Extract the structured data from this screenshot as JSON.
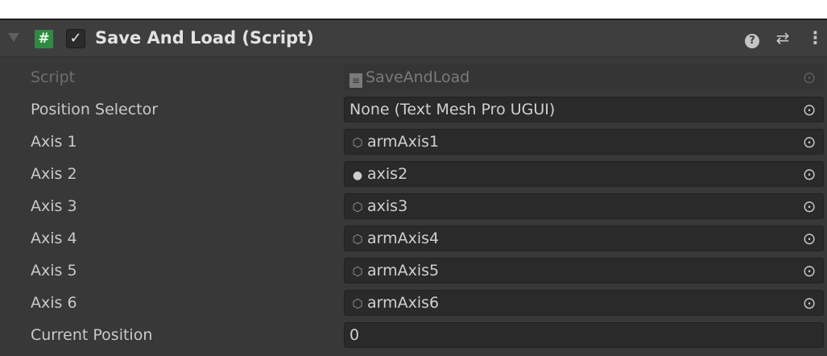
{
  "component": {
    "title": "Save And Load (Script)",
    "script_icon": "#",
    "enabled_check": "✓",
    "help_icon": "?",
    "presets_icon": "⇄",
    "menu_icon": "⋮"
  },
  "fields": [
    {
      "label": "Script",
      "value": "SaveAndLoad",
      "icon": "script-asset-icon",
      "picker": "⊙"
    },
    {
      "label": "Position Selector",
      "value": "None (Text Mesh Pro UGUI)",
      "icon": "",
      "picker": "⊙"
    },
    {
      "label": "Axis 1",
      "value": "armAxis1",
      "icon": "gameobject-icon",
      "picker": "⊙"
    },
    {
      "label": "Axis 2",
      "value": "axis2",
      "icon": "sphere-icon",
      "picker": "⊙"
    },
    {
      "label": "Axis 3",
      "value": "axis3",
      "icon": "gameobject-icon",
      "picker": "⊙"
    },
    {
      "label": "Axis 4",
      "value": "armAxis4",
      "icon": "gameobject-icon",
      "picker": "⊙"
    },
    {
      "label": "Axis 5",
      "value": "armAxis5",
      "icon": "gameobject-icon",
      "picker": "⊙"
    },
    {
      "label": "Axis 6",
      "value": "armAxis6",
      "icon": "gameobject-icon",
      "picker": "⊙"
    },
    {
      "label": "Current Position",
      "value": "0"
    }
  ]
}
